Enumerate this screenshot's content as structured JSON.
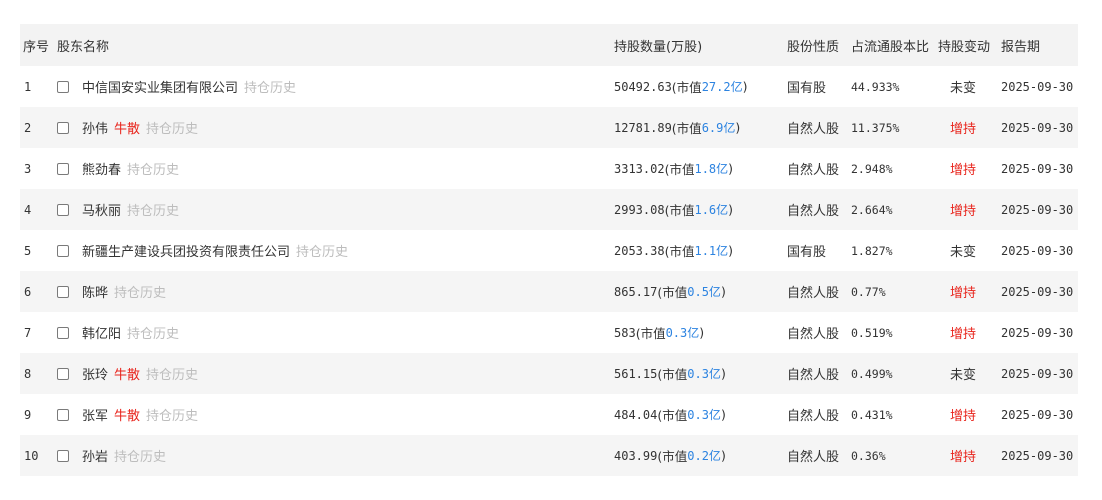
{
  "header": {
    "index": "序号",
    "name": "股东名称",
    "shares": "持股数量(万股)",
    "type": "股份性质",
    "pct": "占流通股本比",
    "change": "持股变动",
    "date": "报告期"
  },
  "rows": [
    {
      "index": "1",
      "name": "中信国安实业集团有限公司",
      "bull": "",
      "history": "持仓历史",
      "shares": "50492.63",
      "mv_prefix": "(市值",
      "mv_value": "27.2亿",
      "mv_suffix": ")",
      "type": "国有股",
      "pct": "44.933%",
      "change": "未变",
      "change_kind": "same",
      "date": "2025-09-30"
    },
    {
      "index": "2",
      "name": "孙伟",
      "bull": "牛散",
      "history": "持仓历史",
      "shares": "12781.89",
      "mv_prefix": "(市值",
      "mv_value": "6.9亿",
      "mv_suffix": ")",
      "type": "自然人股",
      "pct": "11.375%",
      "change": "增持",
      "change_kind": "up",
      "date": "2025-09-30"
    },
    {
      "index": "3",
      "name": "熊劲春",
      "bull": "",
      "history": "持仓历史",
      "shares": "3313.02",
      "mv_prefix": "(市值",
      "mv_value": "1.8亿",
      "mv_suffix": ")",
      "type": "自然人股",
      "pct": "2.948%",
      "change": "增持",
      "change_kind": "up",
      "date": "2025-09-30"
    },
    {
      "index": "4",
      "name": "马秋丽",
      "bull": "",
      "history": "持仓历史",
      "shares": "2993.08",
      "mv_prefix": "(市值",
      "mv_value": "1.6亿",
      "mv_suffix": ")",
      "type": "自然人股",
      "pct": "2.664%",
      "change": "增持",
      "change_kind": "up",
      "date": "2025-09-30"
    },
    {
      "index": "5",
      "name": "新疆生产建设兵团投资有限责任公司",
      "bull": "",
      "history": "持仓历史",
      "shares": "2053.38",
      "mv_prefix": "(市值",
      "mv_value": "1.1亿",
      "mv_suffix": ")",
      "type": "国有股",
      "pct": "1.827%",
      "change": "未变",
      "change_kind": "same",
      "date": "2025-09-30"
    },
    {
      "index": "6",
      "name": "陈晔",
      "bull": "",
      "history": "持仓历史",
      "shares": "865.17",
      "mv_prefix": "(市值",
      "mv_value": "0.5亿",
      "mv_suffix": ")",
      "type": "自然人股",
      "pct": "0.77%",
      "change": "增持",
      "change_kind": "up",
      "date": "2025-09-30"
    },
    {
      "index": "7",
      "name": "韩亿阳",
      "bull": "",
      "history": "持仓历史",
      "shares": "583",
      "mv_prefix": "(市值",
      "mv_value": "0.3亿",
      "mv_suffix": ")",
      "type": "自然人股",
      "pct": "0.519%",
      "change": "增持",
      "change_kind": "up",
      "date": "2025-09-30"
    },
    {
      "index": "8",
      "name": "张玲",
      "bull": "牛散",
      "history": "持仓历史",
      "shares": "561.15",
      "mv_prefix": "(市值",
      "mv_value": "0.3亿",
      "mv_suffix": ")",
      "type": "自然人股",
      "pct": "0.499%",
      "change": "未变",
      "change_kind": "same",
      "date": "2025-09-30"
    },
    {
      "index": "9",
      "name": "张军",
      "bull": "牛散",
      "history": "持仓历史",
      "shares": "484.04",
      "mv_prefix": "(市值",
      "mv_value": "0.3亿",
      "mv_suffix": ")",
      "type": "自然人股",
      "pct": "0.431%",
      "change": "增持",
      "change_kind": "up",
      "date": "2025-09-30"
    },
    {
      "index": "10",
      "name": "孙岩",
      "bull": "",
      "history": "持仓历史",
      "shares": "403.99",
      "mv_prefix": "(市值",
      "mv_value": "0.2亿",
      "mv_suffix": ")",
      "type": "自然人股",
      "pct": "0.36%",
      "change": "增持",
      "change_kind": "up",
      "date": "2025-09-30"
    }
  ],
  "colors": {
    "up": "#e8231b",
    "link": "#2c83e0",
    "muted": "#bdbdbd"
  }
}
